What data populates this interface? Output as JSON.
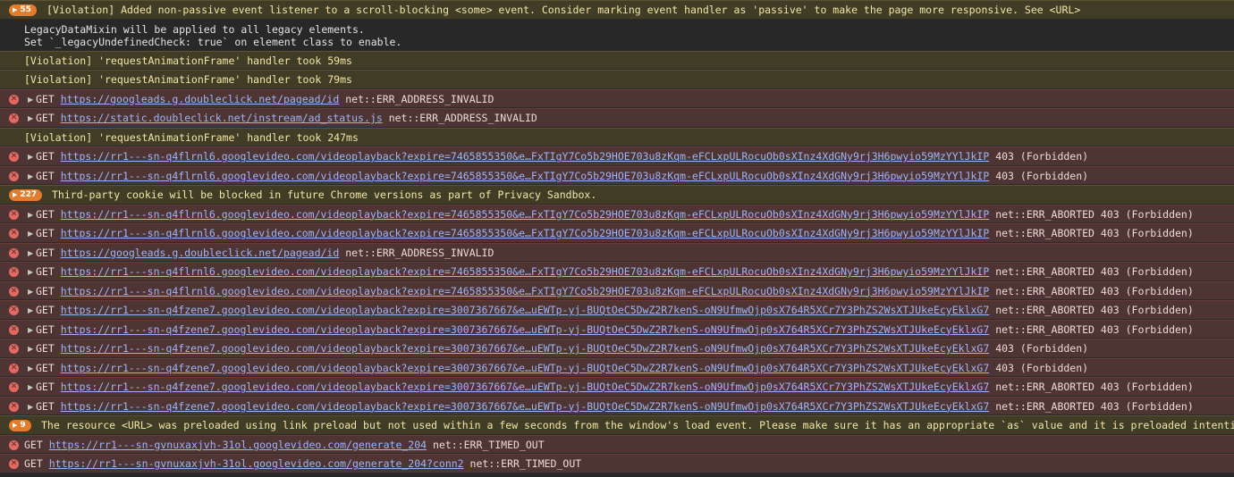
{
  "messages": [
    {
      "kind": "warn",
      "badge": "55",
      "text": "[Violation] Added non-passive event listener to a scroll-blocking <some> event. Consider marking event handler as 'passive' to make the page more responsive. See <URL>"
    },
    {
      "kind": "info",
      "lines": [
        "LegacyDataMixin will be applied to all legacy elements.",
        "Set `_legacyUndefinedCheck: true` on element class to enable."
      ]
    },
    {
      "kind": "warn",
      "text": "[Violation] 'requestAnimationFrame' handler took 59ms"
    },
    {
      "kind": "warn",
      "text": "[Violation] 'requestAnimationFrame' handler took 79ms"
    },
    {
      "kind": "err",
      "caret": true,
      "method": "GET",
      "url": "https://googleads.g.doubleclick.net/pagead/id",
      "suffix": "net::ERR_ADDRESS_INVALID"
    },
    {
      "kind": "err",
      "caret": true,
      "method": "GET",
      "url": "https://static.doubleclick.net/instream/ad_status.js",
      "suffix": "net::ERR_ADDRESS_INVALID"
    },
    {
      "kind": "warn",
      "text": "[Violation] 'requestAnimationFrame' handler took 247ms"
    },
    {
      "kind": "err",
      "caret": true,
      "method": "GET",
      "url": "https://rr1---sn-q4flrnl6.googlevideo.com/videoplayback?expire=7465855350&e…FxTIgY7Co5b29HOE703u8zKqm-eFCLxpULRocuOb0sXInz4XdGNy9rj3H6pwyio59MzYYlJkIP",
      "suffix": "403 (Forbidden)"
    },
    {
      "kind": "err",
      "caret": true,
      "method": "GET",
      "url": "https://rr1---sn-q4flrnl6.googlevideo.com/videoplayback?expire=7465855350&e…FxTIgY7Co5b29HOE703u8zKqm-eFCLxpULRocuOb0sXInz4XdGNy9rj3H6pwyio59MzYYlJkIP",
      "suffix": "403 (Forbidden)"
    },
    {
      "kind": "warn",
      "badge": "227",
      "text": "Third-party cookie will be blocked in future Chrome versions as part of Privacy Sandbox."
    },
    {
      "kind": "err",
      "caret": true,
      "method": "GET",
      "url": "https://rr1---sn-q4flrnl6.googlevideo.com/videoplayback?expire=7465855350&e…FxTIgY7Co5b29HOE703u8zKqm-eFCLxpULRocuOb0sXInz4XdGNy9rj3H6pwyio59MzYYlJkIP",
      "suffix": "net::ERR_ABORTED 403 (Forbidden)"
    },
    {
      "kind": "err",
      "caret": true,
      "method": "GET",
      "url": "https://rr1---sn-q4flrnl6.googlevideo.com/videoplayback?expire=7465855350&e…FxTIgY7Co5b29HOE703u8zKqm-eFCLxpULRocuOb0sXInz4XdGNy9rj3H6pwyio59MzYYlJkIP",
      "suffix": "net::ERR_ABORTED 403 (Forbidden)"
    },
    {
      "kind": "err",
      "caret": true,
      "method": "GET",
      "url": "https://googleads.g.doubleclick.net/pagead/id",
      "suffix": "net::ERR_ADDRESS_INVALID"
    },
    {
      "kind": "err",
      "caret": true,
      "method": "GET",
      "url": "https://rr1---sn-q4flrnl6.googlevideo.com/videoplayback?expire=7465855350&e…FxTIgY7Co5b29HOE703u8zKqm-eFCLxpULRocuOb0sXInz4XdGNy9rj3H6pwyio59MzYYlJkIP",
      "suffix": "net::ERR_ABORTED 403 (Forbidden)"
    },
    {
      "kind": "err",
      "caret": true,
      "method": "GET",
      "url": "https://rr1---sn-q4flrnl6.googlevideo.com/videoplayback?expire=7465855350&e…FxTIgY7Co5b29HOE703u8zKqm-eFCLxpULRocuOb0sXInz4XdGNy9rj3H6pwyio59MzYYlJkIP",
      "suffix": "net::ERR_ABORTED 403 (Forbidden)"
    },
    {
      "kind": "err",
      "caret": true,
      "method": "GET",
      "url": "https://rr1---sn-q4fzene7.googlevideo.com/videoplayback?expire=3007367667&e…uEWTp-yj-BUQtOeC5DwZ2R7kenS-oN9UfmwOjp0sX764R5XCr7Y3PhZS2WsXTJUkeEcyEklxG7",
      "suffix": "net::ERR_ABORTED 403 (Forbidden)"
    },
    {
      "kind": "err",
      "caret": true,
      "method": "GET",
      "url": "https://rr1---sn-q4fzene7.googlevideo.com/videoplayback?expire=3007367667&e…uEWTp-yj-BUQtOeC5DwZ2R7kenS-oN9UfmwOjp0sX764R5XCr7Y3PhZS2WsXTJUkeEcyEklxG7",
      "suffix": "net::ERR_ABORTED 403 (Forbidden)"
    },
    {
      "kind": "err",
      "caret": true,
      "method": "GET",
      "url": "https://rr1---sn-q4fzene7.googlevideo.com/videoplayback?expire=3007367667&e…uEWTp-yj-BUQtOeC5DwZ2R7kenS-oN9UfmwOjp0sX764R5XCr7Y3PhZS2WsXTJUkeEcyEklxG7",
      "suffix": "403 (Forbidden)"
    },
    {
      "kind": "err",
      "caret": true,
      "method": "GET",
      "url": "https://rr1---sn-q4fzene7.googlevideo.com/videoplayback?expire=3007367667&e…uEWTp-yj-BUQtOeC5DwZ2R7kenS-oN9UfmwOjp0sX764R5XCr7Y3PhZS2WsXTJUkeEcyEklxG7",
      "suffix": "403 (Forbidden)"
    },
    {
      "kind": "err",
      "caret": true,
      "method": "GET",
      "url": "https://rr1---sn-q4fzene7.googlevideo.com/videoplayback?expire=3007367667&e…uEWTp-yj-BUQtOeC5DwZ2R7kenS-oN9UfmwOjp0sX764R5XCr7Y3PhZS2WsXTJUkeEcyEklxG7",
      "suffix": "net::ERR_ABORTED 403 (Forbidden)"
    },
    {
      "kind": "err",
      "caret": true,
      "method": "GET",
      "url": "https://rr1---sn-q4fzene7.googlevideo.com/videoplayback?expire=3007367667&e…uEWTp-yj-BUQtOeC5DwZ2R7kenS-oN9UfmwOjp0sX764R5XCr7Y3PhZS2WsXTJUkeEcyEklxG7",
      "suffix": "net::ERR_ABORTED 403 (Forbidden)"
    },
    {
      "kind": "warn",
      "badge": "9",
      "text": "The resource <URL> was preloaded using link preload but not used within a few seconds from the window's load event. Please make sure it has an appropriate `as` value and it is preloaded intentionally."
    },
    {
      "kind": "err",
      "caret": false,
      "method": "GET",
      "url": "https://rr1---sn-gvnuxaxjvh-31ol.googlevideo.com/generate_204",
      "suffix": "net::ERR_TIMED_OUT"
    },
    {
      "kind": "err",
      "caret": false,
      "method": "GET",
      "url": "https://rr1---sn-gvnuxaxjvh-31ol.googlevideo.com/generate_204?conn2",
      "suffix": "net::ERR_TIMED_OUT"
    }
  ],
  "icons": {
    "error": "error-circle-icon",
    "expand": "expand-triangle-icon"
  },
  "colors": {
    "warn_bg": "#413c26",
    "err_bg": "#4e3534",
    "badge": "#e37d2e",
    "link": "#9fb4f6",
    "err_icon": "#e46962"
  }
}
